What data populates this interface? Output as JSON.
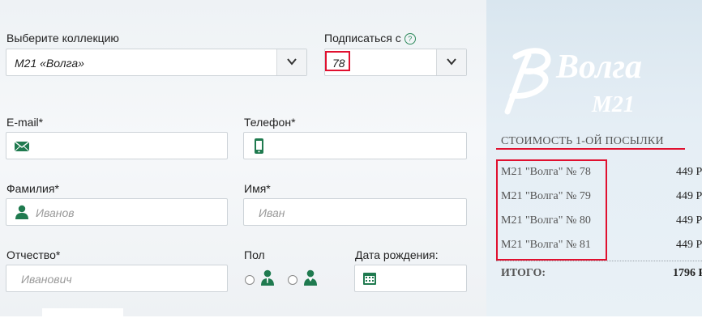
{
  "form": {
    "collection_label": "Выберите коллекцию",
    "collection_value": "М21 «Волга»",
    "subscribe_label": "Подписаться с",
    "subscribe_value": "78",
    "email_label": "E-mail*",
    "phone_label": "Телефон*",
    "lastname_label": "Фамилия*",
    "lastname_placeholder": "Иванов",
    "firstname_label": "Имя*",
    "firstname_placeholder": "Иван",
    "patronymic_label": "Отчество*",
    "patronymic_placeholder": "Иванович",
    "gender_label": "Пол",
    "birthdate_label": "Дата рождения:"
  },
  "summary": {
    "logo_script": "Волга",
    "logo_model": "М21",
    "title": "СТОИМОСТЬ 1-ОЙ ПОСЫЛКИ",
    "items": [
      {
        "name": "М21 \"Волга\" № 78",
        "price": "449 Р"
      },
      {
        "name": "М21 \"Волга\" № 79",
        "price": "449 Р"
      },
      {
        "name": "М21 \"Волга\" № 80",
        "price": "449 Р"
      },
      {
        "name": "М21 \"Волга\" № 81",
        "price": "449 Р"
      }
    ],
    "total_label": "ИТОГО:",
    "total_price": "1796 Р"
  },
  "colors": {
    "accent_green": "#1f7a4f",
    "highlight_red": "#e0102f"
  }
}
